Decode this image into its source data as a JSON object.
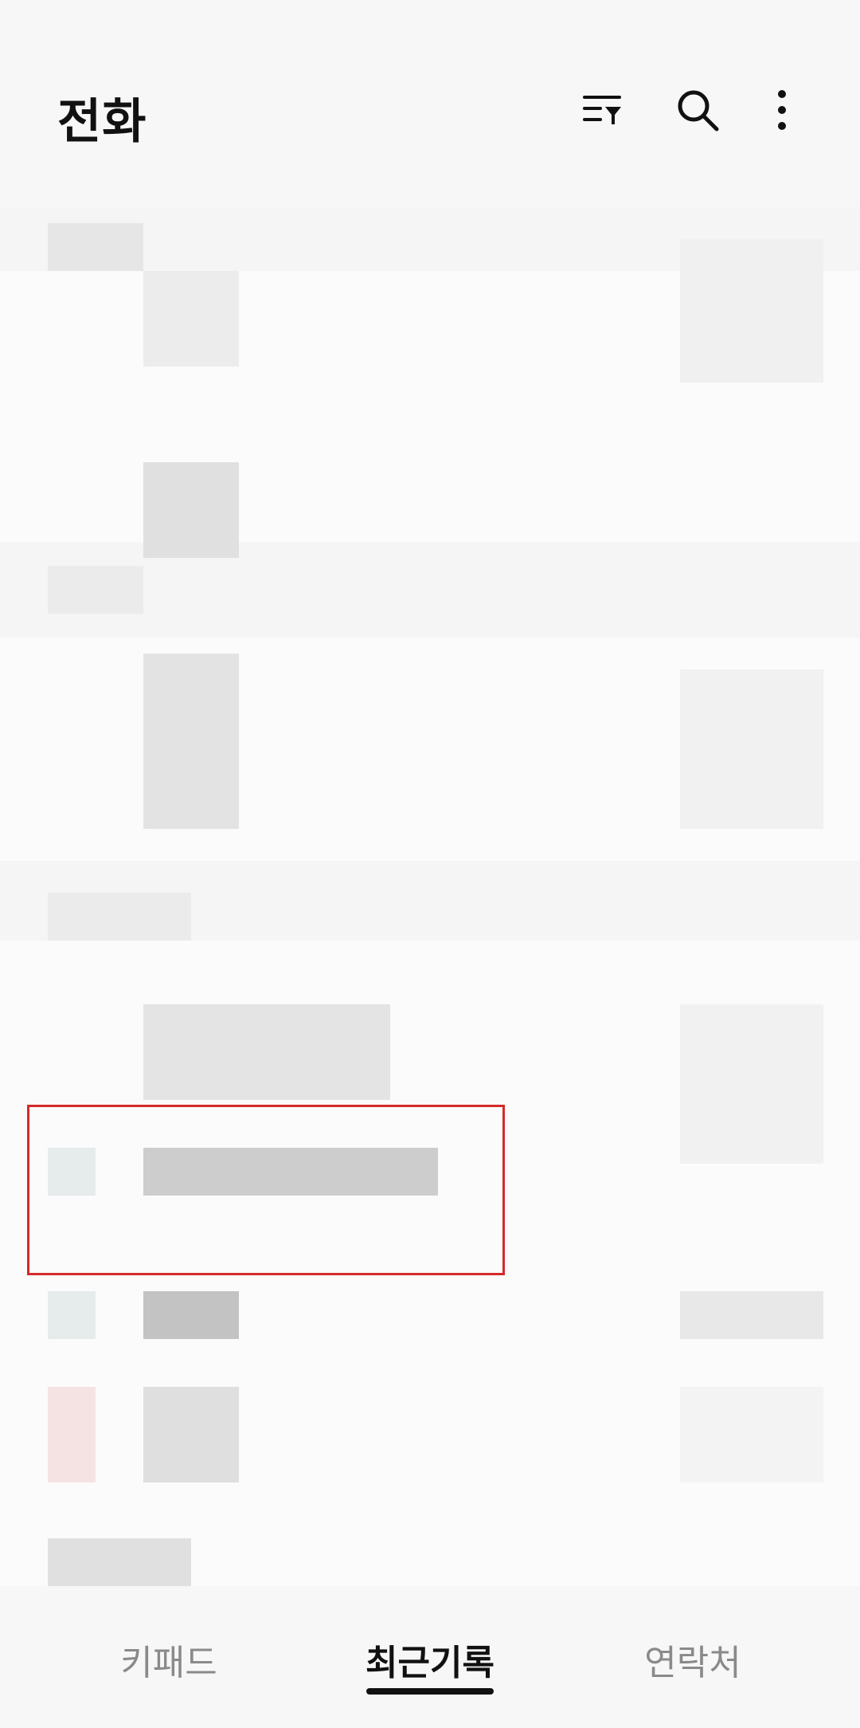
{
  "header": {
    "title": "전화",
    "icons": [
      "filter-icon",
      "search-icon",
      "more-options-icon"
    ]
  },
  "bottom_nav": {
    "tabs": [
      {
        "label": "키패드"
      },
      {
        "label": "최근기록"
      },
      {
        "label": "연락처"
      }
    ],
    "active_index": 1
  },
  "colors": {
    "background": "#f7f7f7",
    "highlight_border": "#d42a2a",
    "active_text": "#111111",
    "inactive_text": "#8a8a8a"
  }
}
